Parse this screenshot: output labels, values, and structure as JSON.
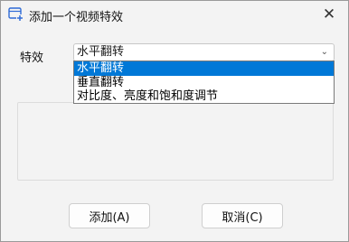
{
  "window": {
    "title": "添加一个视频特效",
    "close_glyph": "✕"
  },
  "form": {
    "effect_label": "特效",
    "effect_select": {
      "selected": "水平翻转",
      "arrow_glyph": "⌄",
      "options": [
        "水平翻转",
        "垂直翻转",
        "对比度、亮度和饱和度调节"
      ],
      "highlighted_index": 0
    }
  },
  "buttons": {
    "add": "添加(A)",
    "cancel": "取消(C)"
  },
  "colors": {
    "selection": "#0078d7",
    "icon_accent": "#2f6bd6"
  }
}
